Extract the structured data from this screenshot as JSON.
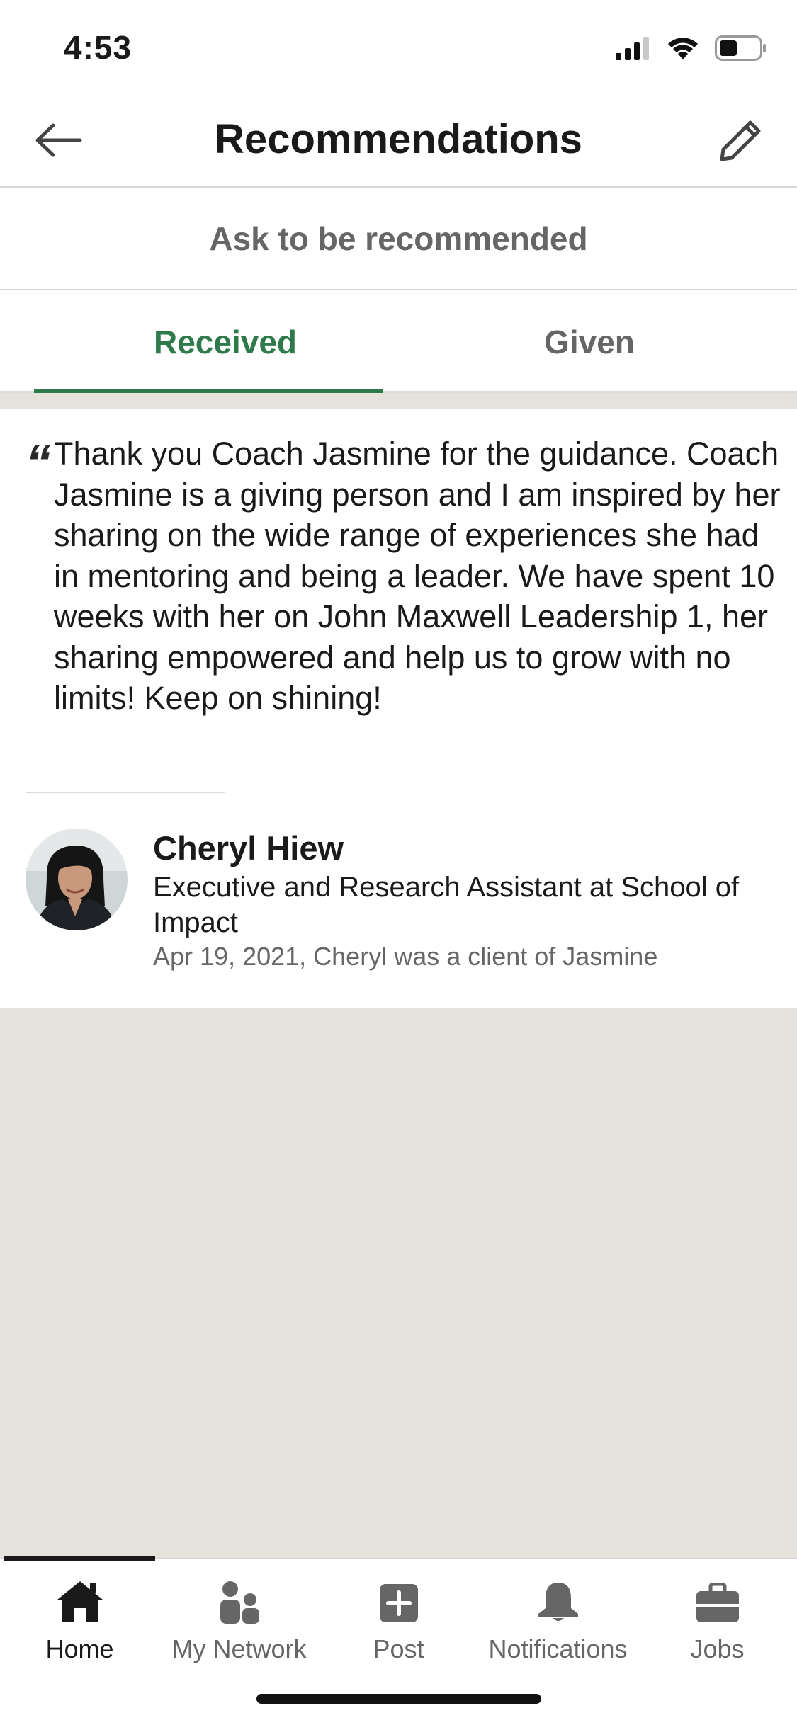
{
  "status_bar": {
    "time": "4:53"
  },
  "header": {
    "title": "Recommendations"
  },
  "ask": {
    "label": "Ask to be recommended"
  },
  "tabs": [
    {
      "label": "Received",
      "active": true
    },
    {
      "label": "Given",
      "active": false
    }
  ],
  "recommendation": {
    "quote_mark": "“",
    "text": "Thank you Coach Jasmine for the guidance. Coach Jasmine is a giving person and I am inspired by her sharing on the wide range of experiences she had in mentoring and being a leader. We have spent 10 weeks with her on John Maxwell Leadership 1, her sharing empowered and help us to grow with no limits! Keep on shining!",
    "recommender": {
      "name": "Cheryl Hiew",
      "headline": "Executive and Research Assistant at School of Impact",
      "meta": "Apr 19, 2021, Cheryl was a client of Jasmine"
    }
  },
  "bottom_nav": [
    {
      "label": "Home",
      "icon": "home-icon",
      "active": true
    },
    {
      "label": "My Network",
      "icon": "network-icon",
      "active": false
    },
    {
      "label": "Post",
      "icon": "post-icon",
      "active": false
    },
    {
      "label": "Notifications",
      "icon": "bell-icon",
      "active": false
    },
    {
      "label": "Jobs",
      "icon": "briefcase-icon",
      "active": false
    }
  ],
  "colors": {
    "accent": "#2f7a4b",
    "background": "#e6e3dd",
    "muted_text": "#666666"
  }
}
